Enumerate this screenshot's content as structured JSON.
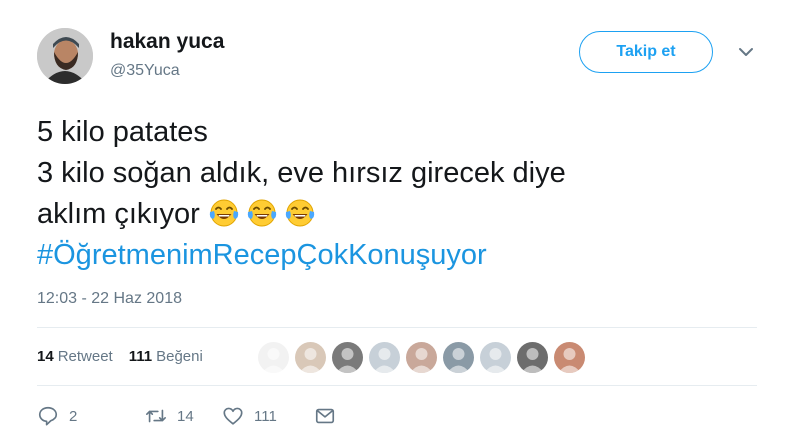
{
  "author": {
    "name": "hakan yuca",
    "handle": "@35Yuca"
  },
  "follow_label": "Takip et",
  "tweet": {
    "line1": "5 kilo patates",
    "line2": "3 kilo soğan aldık, eve hırsız girecek diye",
    "line3": "aklım çıkıyor",
    "emoji_count": 3,
    "hashtag": "#ÖğretmenimRecepÇokKonuşuyor"
  },
  "timestamp": "12:03 - 22 Haz 2018",
  "stats": {
    "retweet_count": "14",
    "retweet_label": "Retweet",
    "like_count": "111",
    "like_label": "Beğeni"
  },
  "liker_count": 9,
  "actions": {
    "reply_count": "2",
    "retweet_count": "14",
    "like_count": "111"
  },
  "colors": {
    "accent": "#1da1f2",
    "hashtag": "#1b95e0",
    "muted": "#657786",
    "text": "#14171a",
    "divider": "#e6ecf0"
  }
}
